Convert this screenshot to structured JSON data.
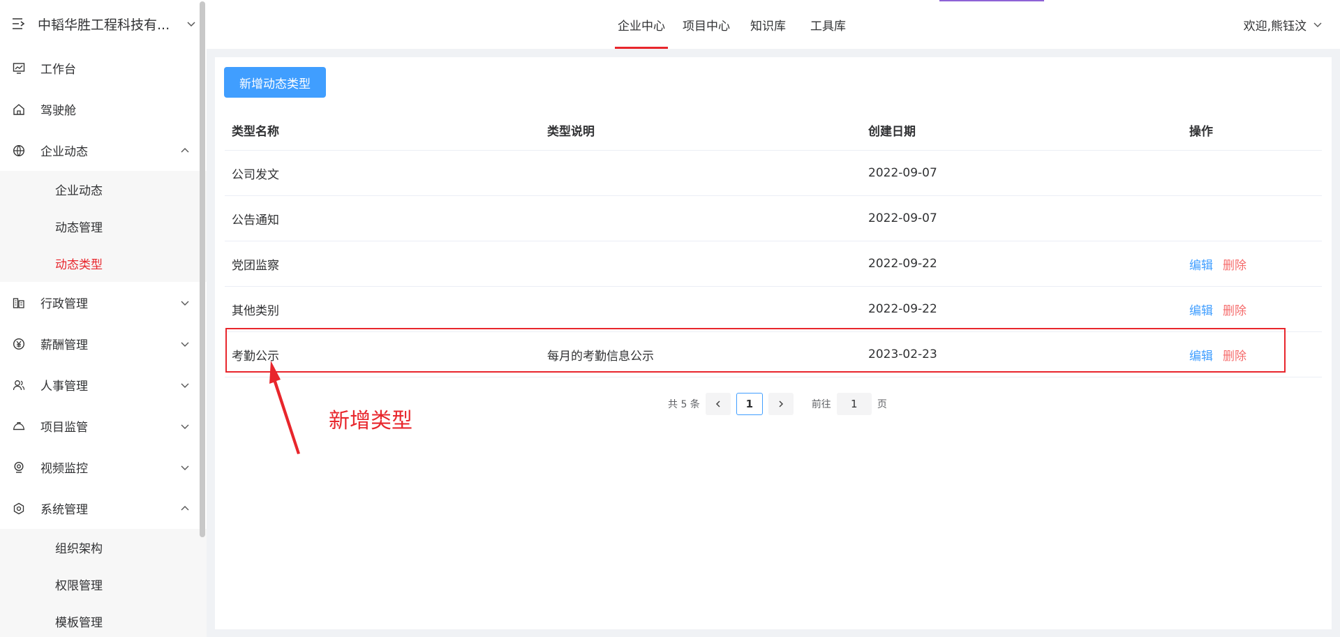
{
  "sidebar": {
    "company": "中韬华胜工程科技有...",
    "items": [
      {
        "label": "工作台",
        "icon": "dashboard-icon"
      },
      {
        "label": "驾驶舱",
        "icon": "home-icon"
      },
      {
        "label": "企业动态",
        "icon": "globe-icon",
        "expanded": true,
        "children": [
          "企业动态",
          "动态管理",
          "动态类型"
        ],
        "active_child": "动态类型"
      },
      {
        "label": "行政管理",
        "icon": "building-icon"
      },
      {
        "label": "薪酬管理",
        "icon": "salary-icon"
      },
      {
        "label": "人事管理",
        "icon": "users-icon"
      },
      {
        "label": "项目监管",
        "icon": "helmet-icon"
      },
      {
        "label": "视频监控",
        "icon": "camera-icon"
      },
      {
        "label": "系统管理",
        "icon": "settings-icon",
        "expanded": true,
        "children": [
          "组织架构",
          "权限管理",
          "模板管理"
        ]
      }
    ]
  },
  "topnav": {
    "tabs": [
      "企业中心",
      "项目中心",
      "知识库",
      "工具库"
    ],
    "active_tab": "企业中心",
    "welcome": "欢迎,熊钰汶"
  },
  "toolbar": {
    "add_label": "新增动态类型"
  },
  "table": {
    "headers": [
      "类型名称",
      "类型说明",
      "创建日期",
      "操作"
    ],
    "rows": [
      {
        "name": "公司发文",
        "desc": "",
        "date": "2022-09-07",
        "ops": []
      },
      {
        "name": "公告通知",
        "desc": "",
        "date": "2022-09-07",
        "ops": []
      },
      {
        "name": "党团监察",
        "desc": "",
        "date": "2022-09-22",
        "ops": [
          "编辑",
          "删除"
        ]
      },
      {
        "name": "其他类别",
        "desc": "",
        "date": "2022-09-22",
        "ops": [
          "编辑",
          "删除"
        ]
      },
      {
        "name": "考勤公示",
        "desc": "每月的考勤信息公示",
        "date": "2023-02-23",
        "ops": [
          "编辑",
          "删除"
        ]
      }
    ]
  },
  "pagination": {
    "total": "共 5 条",
    "current": "1",
    "goto_label": "前往",
    "goto_value": "1",
    "goto_unit": "页"
  },
  "annotation": {
    "text": "新增类型"
  },
  "colors": {
    "accent": "#e8262c",
    "primary": "#409eff",
    "danger": "#f56c6c"
  }
}
